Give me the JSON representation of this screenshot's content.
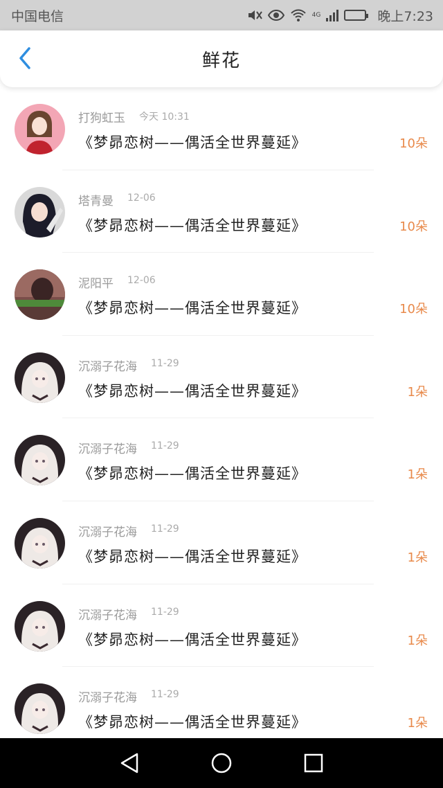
{
  "status_bar": {
    "carrier": "中国电信",
    "network": "4G",
    "time": "晚上7:23",
    "icons": [
      "mute-icon",
      "eye-icon",
      "wifi-icon",
      "signal-icon",
      "battery-icon"
    ]
  },
  "header": {
    "title": "鲜花",
    "back_icon": "chevron-left-icon",
    "accent": "#2f8ee0"
  },
  "items": [
    {
      "name": "打狗虹玉",
      "date": "今天 10:31",
      "book": "《梦昴恋树——偶活全世界蔓延》",
      "count": "10朵",
      "avatar": "avatar-girl-red"
    },
    {
      "name": "塔青曼",
      "date": "12-06",
      "book": "《梦昴恋树——偶活全世界蔓延》",
      "count": "10朵",
      "avatar": "avatar-anime-dark-hair"
    },
    {
      "name": "泥阳平",
      "date": "12-06",
      "book": "《梦昴恋树——偶活全世界蔓延》",
      "count": "10朵",
      "avatar": "avatar-photo-banner"
    },
    {
      "name": "沉溺子花海",
      "date": "11-29",
      "book": "《梦昴恋树——偶活全世界蔓延》",
      "count": "1朵",
      "avatar": "avatar-anime-white-hair"
    },
    {
      "name": "沉溺子花海",
      "date": "11-29",
      "book": "《梦昴恋树——偶活全世界蔓延》",
      "count": "1朵",
      "avatar": "avatar-anime-white-hair"
    },
    {
      "name": "沉溺子花海",
      "date": "11-29",
      "book": "《梦昴恋树——偶活全世界蔓延》",
      "count": "1朵",
      "avatar": "avatar-anime-white-hair"
    },
    {
      "name": "沉溺子花海",
      "date": "11-29",
      "book": "《梦昴恋树——偶活全世界蔓延》",
      "count": "1朵",
      "avatar": "avatar-anime-white-hair"
    },
    {
      "name": "沉溺子花海",
      "date": "11-29",
      "book": "《梦昴恋树——偶活全世界蔓延》",
      "count": "1朵",
      "avatar": "avatar-anime-white-hair"
    }
  ],
  "colors": {
    "count": "#e8894a",
    "name": "#9a9a9a",
    "status_bar_bg": "#d2d2d2",
    "nav_bar_bg": "#000000"
  },
  "system_nav": {
    "icons": [
      "back-triangle-icon",
      "home-circle-icon",
      "recents-square-icon"
    ]
  }
}
